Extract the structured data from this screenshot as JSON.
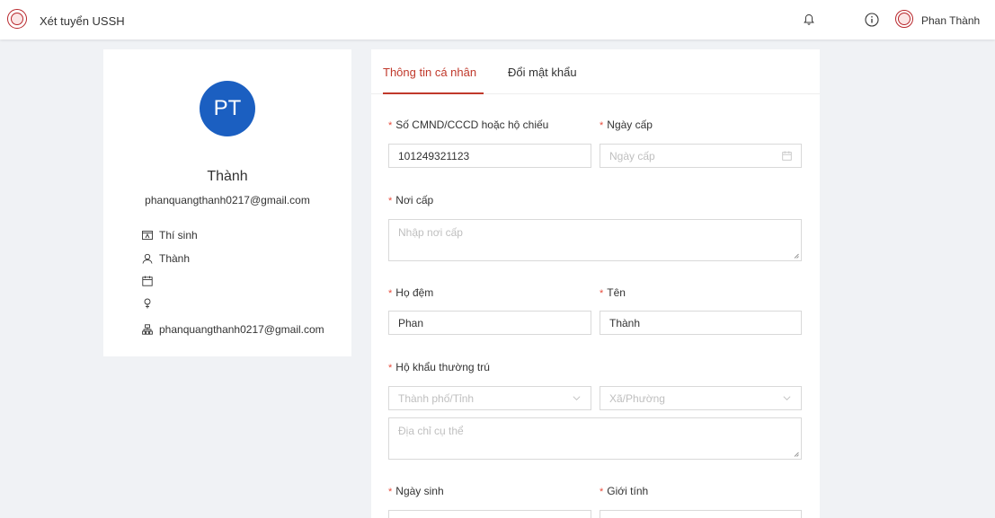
{
  "header": {
    "app_title": "Xét tuyển USSH",
    "user_name": "Phan Thành"
  },
  "profile": {
    "initials": "PT",
    "name": "Thành",
    "email": "phanquangthanh0217@gmail.com",
    "role": "Thí sinh",
    "username": "Thành",
    "birthday": "",
    "gender": "",
    "org_email": "phanquangthanh0217@gmail.com"
  },
  "tabs": {
    "personal": "Thông tin cá nhân",
    "password": "Đổi mật khẩu"
  },
  "form": {
    "id_label": "Số CMND/CCCD hoặc hộ chiếu",
    "id_value": "101249321123",
    "issue_date_label": "Ngày cấp",
    "issue_date_placeholder": "Ngày cấp",
    "issue_place_label": "Nơi cấp",
    "issue_place_placeholder": "Nhập nơi cấp",
    "last_name_label": "Họ đệm",
    "last_name_value": "Phan",
    "first_name_label": "Tên",
    "first_name_value": "Thành",
    "residence_label": "Hộ khẩu thường trú",
    "city_placeholder": "Thành phố/Tỉnh",
    "ward_placeholder": "Xã/Phường",
    "address_placeholder": "Địa chỉ cụ thể",
    "dob_label": "Ngày sinh",
    "gender_label": "Giới tính"
  },
  "colors": {
    "accent": "#c0392b",
    "avatar": "#1b5fc1",
    "required": "#e74c3c"
  }
}
